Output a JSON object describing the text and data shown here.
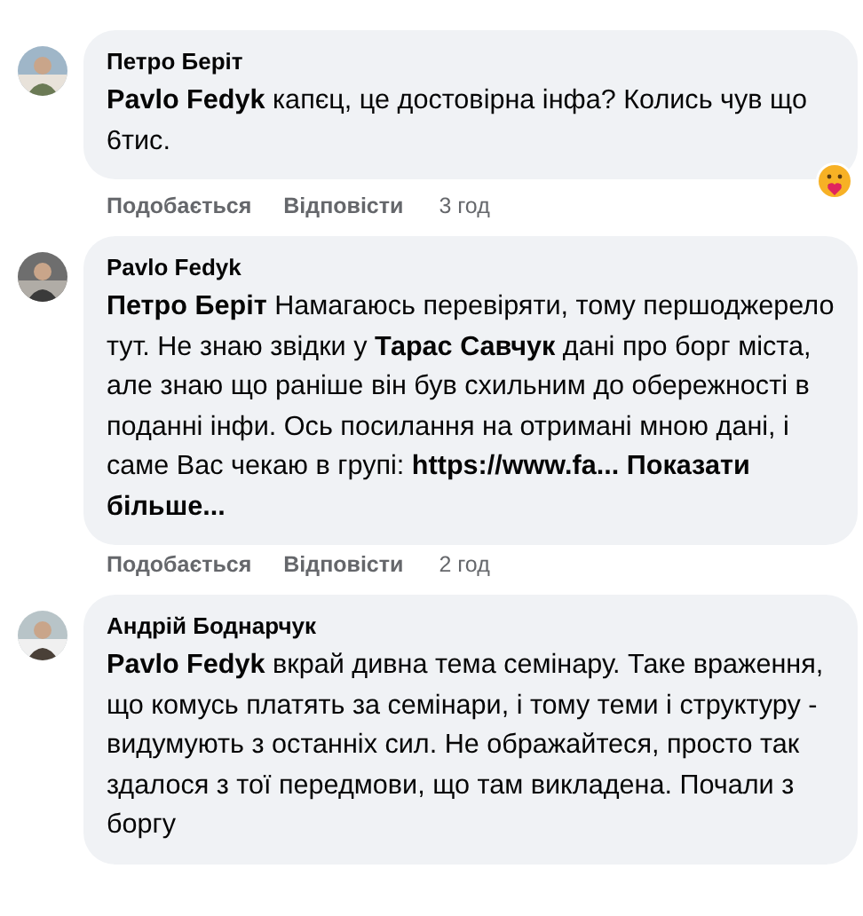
{
  "comments": [
    {
      "author": "Петро Беріт",
      "body": "**Pavlo Fedyk** капєц, це достовірна інфа? Колись чув що 6тис.",
      "reacted": true,
      "actions": {
        "like": "Подобається",
        "reply": "Відповісти",
        "time": "3 год"
      }
    },
    {
      "author": "Pavlo Fedyk",
      "body": "**Петро Беріт** Намагаюсь перевіряти, тому першоджерело тут. Не знаю звідки у **Тарас Савчук** дані про борг міста, але знаю що раніше він був схильним до обережності в поданні інфи. Ось посилання на отримані мною дані, і саме Вас чекаю в групі: **https://www.fa... Показати більше...**",
      "actions": {
        "like": "Подобається",
        "reply": "Відповісти",
        "time": "2 год"
      }
    },
    {
      "author": "Андрій Боднарчук",
      "body": "**Pavlo Fedyk** вкрай дивна тема семінару. Таке враження, що комусь платять за семінари, і тому теми і структуру - видумують з останніх сил. Не ображайтеся, просто так здалося з тої передмови, що там викладена. Почали з боргу"
    }
  ]
}
